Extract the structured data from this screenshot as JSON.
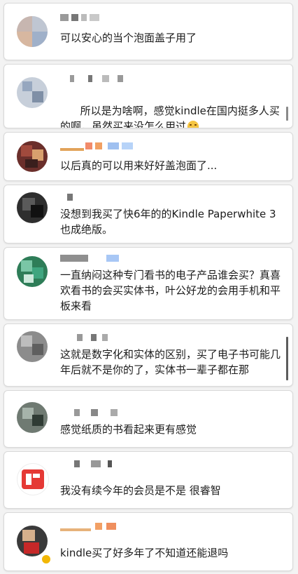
{
  "comments": [
    {
      "text": "可以安心的当个泡面盖子用了"
    },
    {
      "text": "所以是为啥啊，感觉kindle在国内挺多人买的啊，虽然买来没怎么用过",
      "emoji": "laughing-crying-emoji"
    },
    {
      "text": "以后真的可以用来好好盖泡面了..."
    },
    {
      "text": "没想到我买了快6年的的Kindle Paperwhite 3也成绝版。"
    },
    {
      "text": "一直纳闷这种专门看书的电子产品谁会买？真喜欢看书的会买实体书，叶公好龙的会用手机和平板来看"
    },
    {
      "text": "这就是数字化和实体的区别，买了电子书可能几年后就不是你的了，实体书一辈子都在那"
    },
    {
      "text": "感觉纸质的书看起来更有感觉"
    },
    {
      "text": "我没有续今年的会员是不是 很睿智"
    },
    {
      "text": "kindle买了好多年了不知道还能退吗"
    }
  ]
}
